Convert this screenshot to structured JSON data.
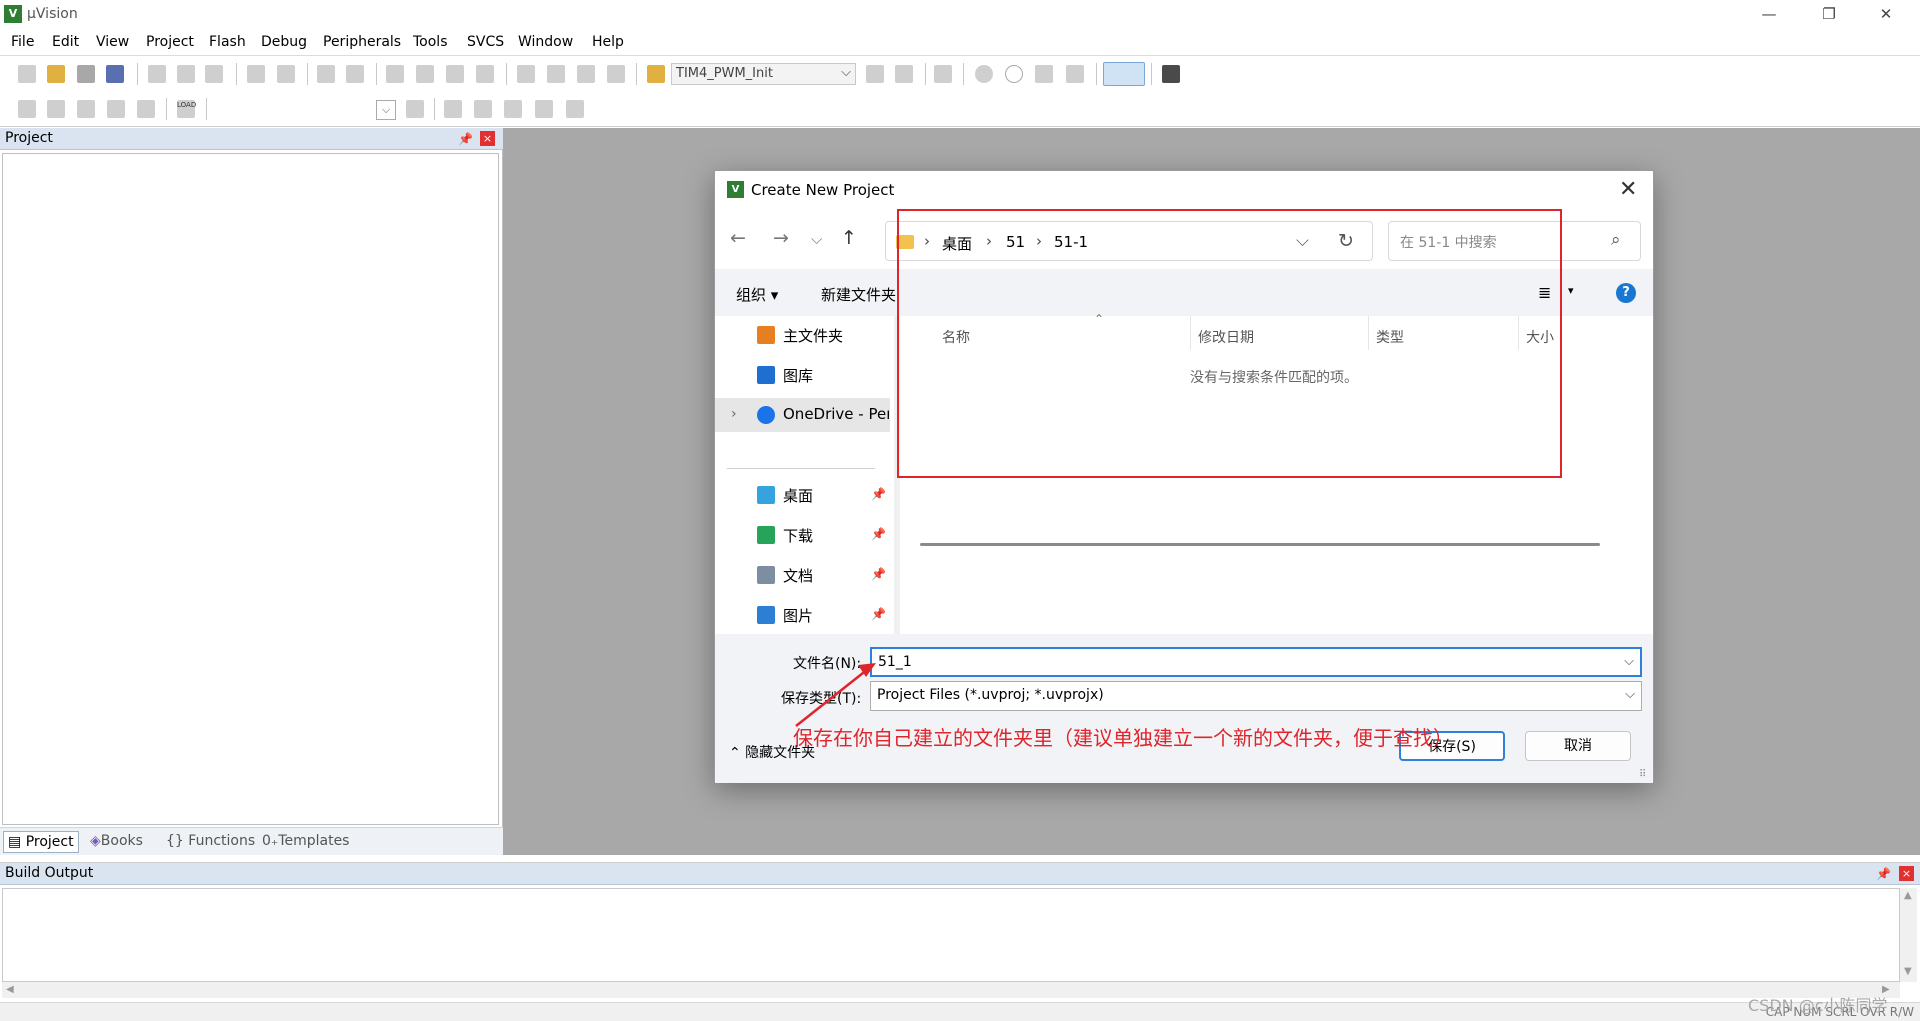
{
  "app": {
    "title": "µVision",
    "logo": "V"
  },
  "window_controls": {
    "minimize": "—",
    "restore": "❐",
    "close": "✕"
  },
  "menu": [
    "File",
    "Edit",
    "View",
    "Project",
    "Flash",
    "Debug",
    "Peripherals",
    "Tools",
    "SVCS",
    "Window",
    "Help"
  ],
  "toolbar": {
    "target": "TIM4_PWM_Init",
    "combo_arrow": "⌵",
    "load": "LOAD"
  },
  "project_panel": {
    "title": "Project",
    "pin": "📌",
    "close": "×",
    "tabs": [
      "Project",
      "Books",
      "Functions",
      "Templates"
    ],
    "tab_icons": [
      "▤",
      "◈",
      "{}",
      "0₊"
    ]
  },
  "build_output": {
    "title": "Build Output",
    "pin": "📌",
    "close": "×",
    "scroll_up": "▲",
    "scroll_down": "▼",
    "scroll_left": "◀",
    "scroll_right": "▶"
  },
  "statusbar": {
    "text": "CAP  NUM  SCRL  OVR  R/W"
  },
  "watermark": "CSDN @c小陈同学",
  "dialog": {
    "title": "Create New Project",
    "close": "✕",
    "nav": {
      "back": "←",
      "forward": "→",
      "recent": "⌵",
      "up": "↑"
    },
    "breadcrumb": [
      "桌面",
      "51",
      "51-1"
    ],
    "breadcrumb_sep": "›",
    "address_dropdown": "⌵",
    "refresh": "↻",
    "search_placeholder": "在 51-1 中搜索",
    "search_icon": "⌕",
    "commands": {
      "organize": "组织 ▾",
      "new_folder": "新建文件夹"
    },
    "view_icon": "≣",
    "view_dropdown": "▾",
    "help": "?",
    "nav_items": [
      {
        "label": "主文件夹",
        "icon": "home-icon",
        "color": "#e67e22"
      },
      {
        "label": "图库",
        "icon": "gallery-icon",
        "color": "#1f6fd1"
      },
      {
        "label": "OneDrive - Pers",
        "icon": "onedrive-icon",
        "color": "#1a73e8",
        "expander": "›"
      },
      {
        "label": "桌面",
        "icon": "desktop-icon",
        "color": "#34a3e0",
        "pin": "📌"
      },
      {
        "label": "下载",
        "icon": "download-icon",
        "color": "#27a35a",
        "pin": "📌"
      },
      {
        "label": "文档",
        "icon": "documents-icon",
        "color": "#7d8ea3",
        "pin": "📌"
      },
      {
        "label": "图片",
        "icon": "pictures-icon",
        "color": "#2d7fd3",
        "pin": "📌"
      }
    ],
    "columns": [
      "名称",
      "修改日期",
      "类型",
      "大小"
    ],
    "sort_indicator": "⌃",
    "empty_message": "没有与搜索条件匹配的项。",
    "filename_label": "文件名(N):",
    "filename_value": "51_1",
    "filetype_label": "保存类型(T):",
    "filetype_value": "Project Files (*.uvproj; *.uvprojx)",
    "dropdown_arrow": "⌵",
    "hide_folders": "⌃  隐藏文件夹",
    "save_button": "保存(S)",
    "cancel_button": "取消",
    "resize_grip": "⠿"
  },
  "annotation": {
    "text": "保存在你自己建立的文件夹里（建议单独建立一个新的文件夹，便于查找）",
    "color": "#e0242b"
  }
}
